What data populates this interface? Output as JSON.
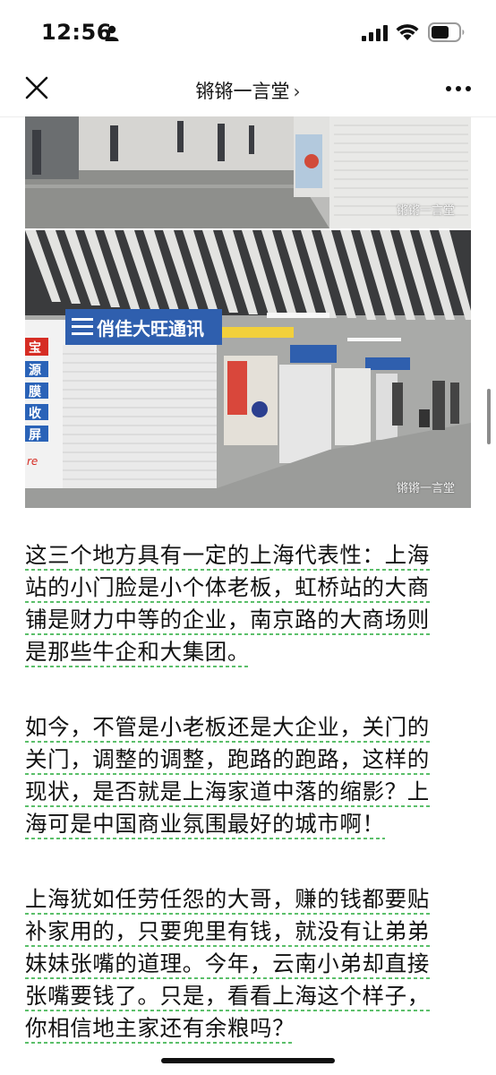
{
  "status_bar": {
    "time": "12:56"
  },
  "nav": {
    "title": "锵锵一言堂",
    "chevron": "›",
    "icons": [
      "close-icon",
      "more-icon"
    ]
  },
  "photos": {
    "watermark": "锵锵一言堂"
  },
  "article": {
    "p1": [
      "这三个地方具有一定的上海代表性：上海",
      "站的小门脸是小个体老板，虹桥站的大商",
      "铺是财力中等的企业，南京路的大商场则",
      "是那些牛企和大集团。"
    ],
    "p2": [
      "如今，不管是小老板还是大企业，关门的",
      "关门，调整的调整，跑路的跑路，这样的",
      "现状，是否就是上海家道中落的缩影？上",
      "海可是中国商业氛围最好的城市啊！"
    ],
    "p3": [
      "上海犹如任劳任怨的大哥，赚的钱都要贴",
      "补家用的，只要兜里有钱，就没有让弟弟",
      "妹妹张嘴的道理。今年，云南小弟却直接",
      "张嘴要钱了。只是，看看上海这个样子，",
      "你相信地主家还有余粮吗？"
    ]
  },
  "photo_sign_text": [
    "俏佳大旺通讯",
    "宝",
    "源",
    "膜",
    "收",
    "屏",
    "re"
  ]
}
